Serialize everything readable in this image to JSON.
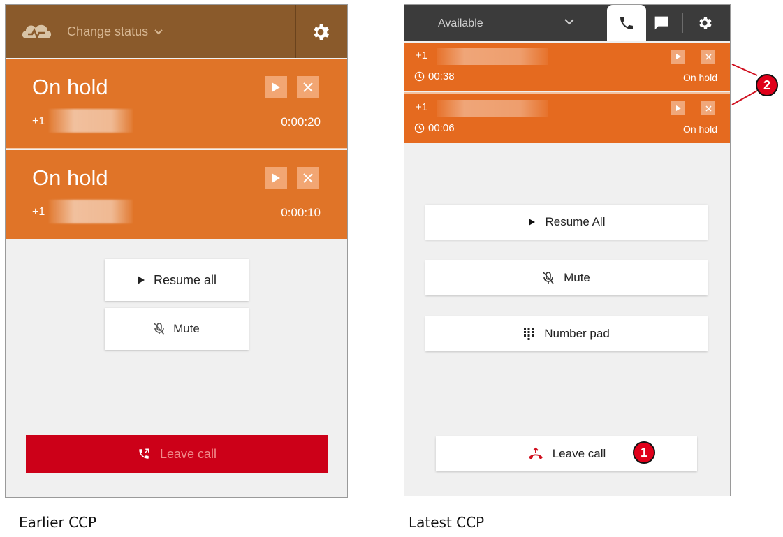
{
  "earlier": {
    "caption": "Earlier CCP",
    "change_status_label": "Change status",
    "calls": [
      {
        "state": "On hold",
        "number_prefix": "+1",
        "elapsed": "0:00:20"
      },
      {
        "state": "On hold",
        "number_prefix": "+1",
        "elapsed": "0:00:10"
      }
    ],
    "resume_label": "Resume all",
    "mute_label": "Mute",
    "leave_label": "Leave call"
  },
  "latest": {
    "caption": "Latest CCP",
    "status_label": "Available",
    "calls": [
      {
        "number_prefix": "+1",
        "timer": "00:38",
        "state": "On hold"
      },
      {
        "number_prefix": "+1",
        "timer": "00:06",
        "state": "On hold"
      }
    ],
    "resume_label": "Resume All",
    "mute_label": "Mute",
    "number_pad_label": "Number pad",
    "leave_label": "Leave call"
  },
  "callouts": {
    "one": "1",
    "two": "2"
  },
  "colors": {
    "old_header": "#8a5a2b",
    "call_orange": "#e07428",
    "leave_red": "#cc0018",
    "new_header": "#3b3b3b",
    "callout_red": "#e0001a"
  }
}
